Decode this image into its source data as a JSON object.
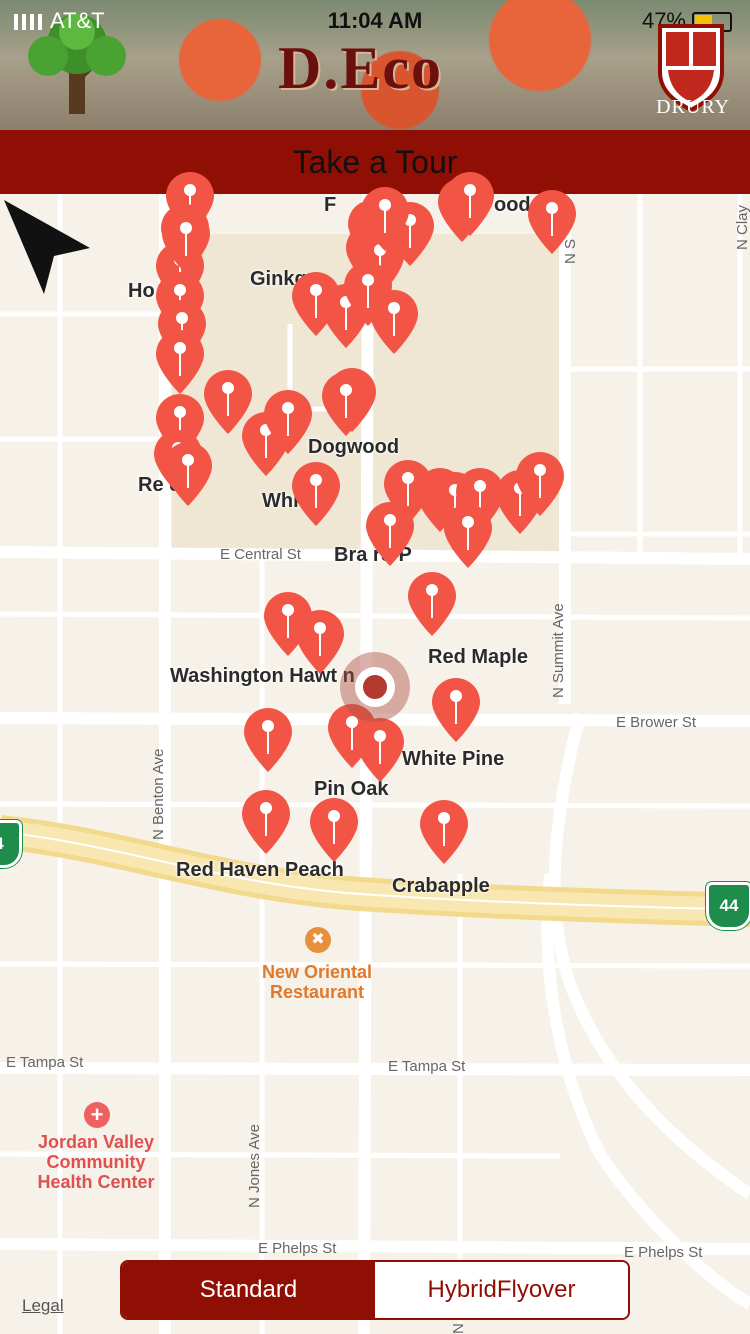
{
  "status_bar": {
    "carrier": "AT&T",
    "time": "11:04 AM",
    "battery": "47%"
  },
  "header": {
    "title": "D.Eco",
    "partner": "DRURY"
  },
  "tour_button": {
    "label": "Take a Tour"
  },
  "map": {
    "road_labels": {
      "central": "E Central St",
      "brower": "E Brower St",
      "benton": "N Benton Ave",
      "summit": "N Summit Ave",
      "tampa_left": "E Tampa St",
      "tampa_right": "E Tampa St",
      "jones": "N Jones Ave",
      "phelps_left": "E Phelps St",
      "phelps_right": "E Phelps St",
      "clay": "N Clay",
      "n_s": "N S",
      "ridge": "N Ridge A"
    },
    "tree_labels": {
      "hornbeam": "Ho      am",
      "ginkgo": "Ginkgo",
      "dogwood": "Dogwood",
      "redbud": "Re      d",
      "whitebirch": "Whi       h",
      "bradford": "Bra      rd P",
      "red_maple": "Red Maple",
      "washington": "Washington Hawt      n",
      "white_pine": "White Pine",
      "pin_oak": "Pin Oak",
      "red_haven": "Red Haven Peach",
      "crabapple": "Crabapple",
      "top_f": "F",
      "top_wood": "ood"
    },
    "pois": {
      "restaurant": {
        "name_line1": "New Oriental",
        "name_line2": "Restaurant",
        "icon": "fork-knife-icon"
      },
      "health": {
        "name_line1": "Jordan Valley",
        "name_line2": "Community",
        "name_line3": "Health Center",
        "icon": "plus-icon"
      }
    },
    "highway_shield": "44",
    "highway_shield_left": "4",
    "legal": "Legal"
  },
  "map_type": {
    "options": [
      "Standard",
      "HybridFlyover"
    ],
    "selected": "Standard"
  },
  "colors": {
    "brand": "#8f0f04",
    "pin": "#f25546"
  }
}
